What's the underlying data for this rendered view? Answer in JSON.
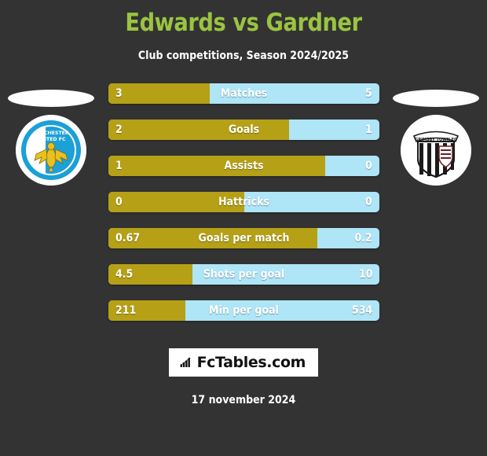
{
  "header": {
    "title": "Edwards vs Gardner",
    "subtitle": "Club competitions, Season 2024/2025",
    "title_color": "#9ac441"
  },
  "teams": {
    "home": {
      "name": "Colchester United FC",
      "badge_line1": "COLCHESTER",
      "badge_line2": "UNITED FC",
      "colors": {
        "primary": "#1ba0d7",
        "secondary": "#ffffff",
        "accent": "#e8c020"
      }
    },
    "away": {
      "name": "Grimsby Town FC",
      "badge_text": "GRIMSBY TOWN FC",
      "colors": {
        "primary": "#1a1a1a",
        "secondary": "#ffffff",
        "accent": "#6e1f24"
      }
    }
  },
  "colors": {
    "background": "#333333",
    "bar_home": "#b5a016",
    "bar_away": "#aee5f7",
    "text": "#ffffff"
  },
  "chart_data": {
    "type": "bar",
    "title": "Edwards vs Gardner",
    "subtitle": "Club competitions, Season 2024/2025",
    "orientation": "horizontal-diverging",
    "series": [
      {
        "name": "Edwards",
        "team": "Colchester United FC",
        "color": "#b5a016"
      },
      {
        "name": "Gardner",
        "team": "Grimsby Town FC",
        "color": "#aee5f7"
      }
    ],
    "categories": [
      "Matches",
      "Goals",
      "Assists",
      "Hattricks",
      "Goals per match",
      "Shots per goal",
      "Min per goal"
    ],
    "rows": [
      {
        "label": "Matches",
        "home": "3",
        "away": "5",
        "home_pct": 37.5
      },
      {
        "label": "Goals",
        "home": "2",
        "away": "1",
        "home_pct": 66.7
      },
      {
        "label": "Assists",
        "home": "1",
        "away": "0",
        "home_pct": 80.0
      },
      {
        "label": "Hattricks",
        "home": "0",
        "away": "0",
        "home_pct": 50.0
      },
      {
        "label": "Goals per match",
        "home": "0.67",
        "away": "0.2",
        "home_pct": 77.0
      },
      {
        "label": "Shots per goal",
        "home": "4.5",
        "away": "10",
        "home_pct": 31.0
      },
      {
        "label": "Min per goal",
        "home": "211",
        "away": "534",
        "home_pct": 28.3
      }
    ]
  },
  "footer": {
    "logo_text": "FcTables.com",
    "logo_icon": "bar-chart-arrow-icon",
    "date": "17 november 2024"
  }
}
